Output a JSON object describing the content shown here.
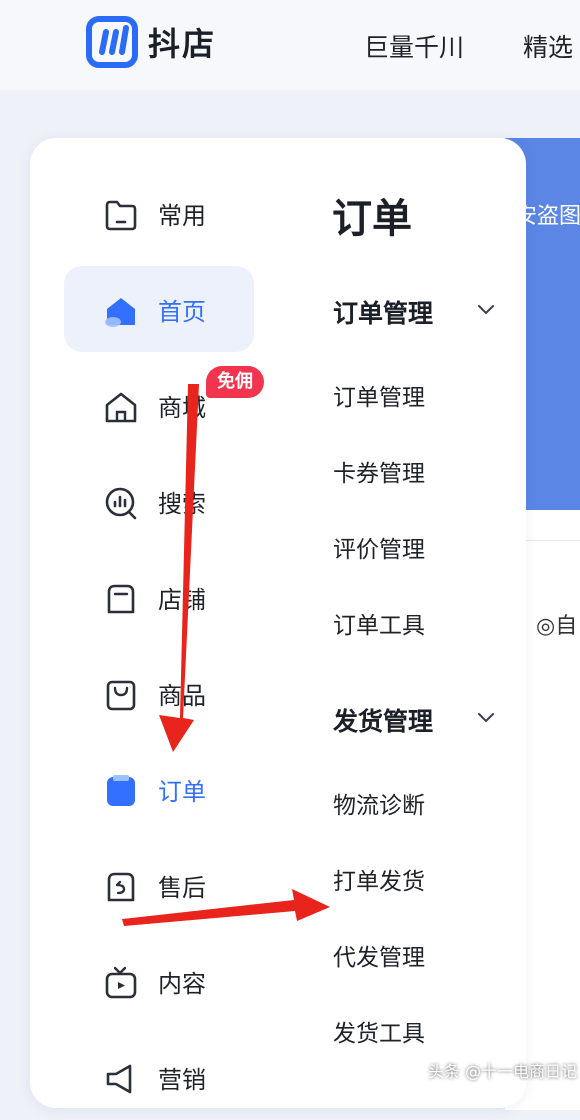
{
  "header": {
    "logo_text": "抖店",
    "nav": [
      "巨量千川",
      "精选"
    ]
  },
  "background": {
    "banner_text": "安盗图",
    "content_text": "◎自"
  },
  "sidebar": {
    "items": [
      {
        "label": "常用",
        "icon": "folder-icon"
      },
      {
        "label": "首页",
        "icon": "home-icon"
      },
      {
        "label": "商城",
        "icon": "mall-icon"
      },
      {
        "label": "搜索",
        "icon": "search-chart-icon"
      },
      {
        "label": "店铺",
        "icon": "store-icon"
      },
      {
        "label": "商品",
        "icon": "bag-icon"
      },
      {
        "label": "订单",
        "icon": "order-icon"
      },
      {
        "label": "售后",
        "icon": "after-sale-icon"
      },
      {
        "label": "内容",
        "icon": "tv-icon"
      },
      {
        "label": "营销",
        "icon": "megaphone-icon"
      }
    ],
    "badge": "免佣"
  },
  "submenu": {
    "title": "订单",
    "groups": [
      {
        "title": "订单管理",
        "items": [
          "订单管理",
          "卡券管理",
          "评价管理",
          "订单工具"
        ]
      },
      {
        "title": "发货管理",
        "items": [
          "物流诊断",
          "打单发货",
          "代发管理",
          "发货工具"
        ]
      }
    ]
  },
  "colors": {
    "accent": "#3370ff",
    "badge": "#f2344f",
    "arrow": "#e8241c"
  },
  "watermark": "头条 @十一电商日记"
}
